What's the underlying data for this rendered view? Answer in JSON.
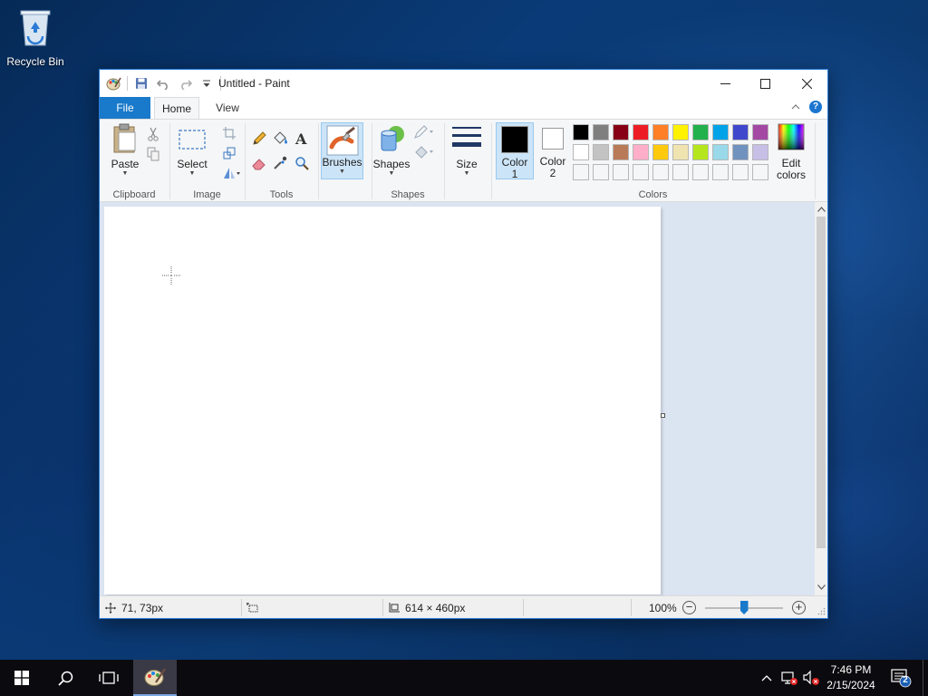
{
  "desktop": {
    "recycle_bin_label": "Recycle Bin"
  },
  "window": {
    "title": "Untitled - Paint",
    "tabs": {
      "file": "File",
      "home": "Home",
      "view": "View"
    }
  },
  "ribbon": {
    "clipboard": {
      "paste": "Paste",
      "group": "Clipboard"
    },
    "image": {
      "select": "Select",
      "group": "Image"
    },
    "tools": {
      "group": "Tools"
    },
    "brushes": {
      "label": "Brushes"
    },
    "shapes": {
      "label": "Shapes",
      "group": "Shapes"
    },
    "size": {
      "label": "Size"
    },
    "color1": {
      "line1": "Color",
      "line2": "1",
      "color": "#000000"
    },
    "color2": {
      "line1": "Color",
      "line2": "2",
      "color": "#ffffff"
    },
    "edit_colors": {
      "line1": "Edit",
      "line2": "colors"
    },
    "colors_group": "Colors",
    "palette_row1": [
      "#000000",
      "#7f7f7f",
      "#880015",
      "#ed1c24",
      "#ff7f27",
      "#fff200",
      "#22b14c",
      "#00a2e8",
      "#3f48cc",
      "#a349a4"
    ],
    "palette_row2": [
      "#ffffff",
      "#c3c3c3",
      "#b97a57",
      "#ffaec9",
      "#ffc90e",
      "#efe4b0",
      "#b5e61d",
      "#99d9ea",
      "#7092be",
      "#c8bfe7"
    ],
    "palette_row3": [
      "#f5f6f7",
      "#f5f6f7",
      "#f5f6f7",
      "#f5f6f7",
      "#f5f6f7",
      "#f5f6f7",
      "#f5f6f7",
      "#f5f6f7",
      "#f5f6f7",
      "#f5f6f7"
    ]
  },
  "statusbar": {
    "cursor_pos": "71, 73px",
    "canvas_size": "614 × 460px",
    "zoom": "100%",
    "zoom_level_fraction": 0.5
  },
  "taskbar": {
    "time": "7:46 PM",
    "date": "2/15/2024",
    "notification_count": "2"
  }
}
